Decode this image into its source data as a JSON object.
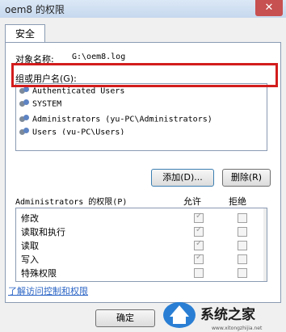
{
  "window": {
    "title": "oem8 的权限",
    "close": "✕"
  },
  "tab": {
    "label": "安全"
  },
  "object": {
    "label": "对象名称:",
    "value": "G:\\oem8.log"
  },
  "groups": {
    "label": "组或用户名(G):",
    "items": [
      "Authenticated Users",
      "SYSTEM",
      "Administrators (yu-PC\\Administrators)",
      "Users (yu-PC\\Users)"
    ]
  },
  "buttons": {
    "add": "添加(D)...",
    "remove": "删除(R)",
    "ok": "确定"
  },
  "permissions": {
    "label": "Administrators 的权限(P)",
    "allow_header": "允许",
    "deny_header": "拒绝",
    "rows": [
      {
        "name": "修改",
        "allow": true,
        "deny": false
      },
      {
        "name": "读取和执行",
        "allow": true,
        "deny": false
      },
      {
        "name": "读取",
        "allow": true,
        "deny": false
      },
      {
        "name": "写入",
        "allow": true,
        "deny": false
      },
      {
        "name": "特殊权限",
        "allow": false,
        "deny": false
      }
    ]
  },
  "link": "了解访问控制和权限",
  "watermark": {
    "text": "系统之家",
    "url": "www.xitongzhijia.net"
  }
}
